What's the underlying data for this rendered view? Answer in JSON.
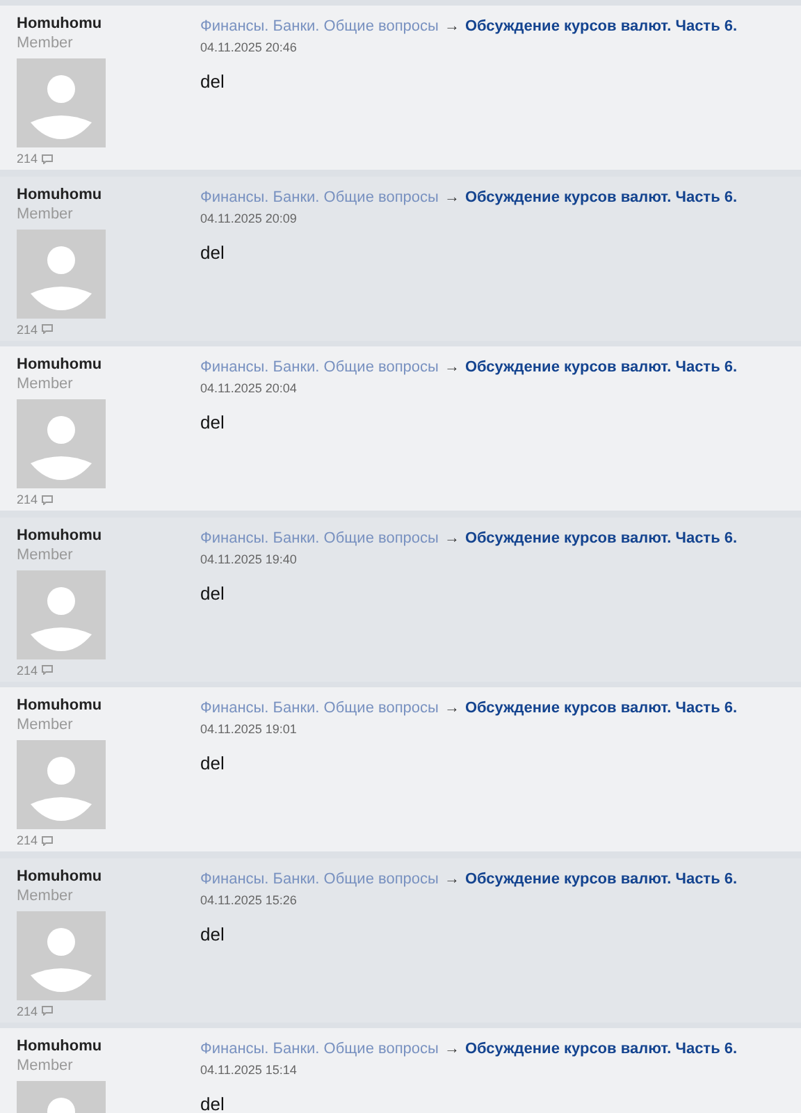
{
  "posts": [
    {
      "author": "Homuhomu",
      "role": "Member",
      "count": "214",
      "forum": "Финансы. Банки. Общие вопросы",
      "arrow": "→",
      "topic": "Обсуждение курсов валют. Часть 6.",
      "date": "04.11.2025 20:46",
      "body": "del",
      "shaded": false
    },
    {
      "author": "Homuhomu",
      "role": "Member",
      "count": "214",
      "forum": "Финансы. Банки. Общие вопросы",
      "arrow": "→",
      "topic": "Обсуждение курсов валют. Часть 6.",
      "date": "04.11.2025 20:09",
      "body": "del",
      "shaded": true
    },
    {
      "author": "Homuhomu",
      "role": "Member",
      "count": "214",
      "forum": "Финансы. Банки. Общие вопросы",
      "arrow": "→",
      "topic": "Обсуждение курсов валют. Часть 6.",
      "date": "04.11.2025 20:04",
      "body": "del",
      "shaded": false
    },
    {
      "author": "Homuhomu",
      "role": "Member",
      "count": "214",
      "forum": "Финансы. Банки. Общие вопросы",
      "arrow": "→",
      "topic": "Обсуждение курсов валют. Часть 6.",
      "date": "04.11.2025 19:40",
      "body": "del",
      "shaded": true
    },
    {
      "author": "Homuhomu",
      "role": "Member",
      "count": "214",
      "forum": "Финансы. Банки. Общие вопросы",
      "arrow": "→",
      "topic": "Обсуждение курсов валют. Часть 6.",
      "date": "04.11.2025 19:01",
      "body": "del",
      "shaded": false
    },
    {
      "author": "Homuhomu",
      "role": "Member",
      "count": "214",
      "forum": "Финансы. Банки. Общие вопросы",
      "arrow": "→",
      "topic": "Обсуждение курсов валют. Часть 6.",
      "date": "04.11.2025 15:26",
      "body": "del",
      "shaded": true
    },
    {
      "author": "Homuhomu",
      "role": "Member",
      "forum": "Финансы. Банки. Общие вопросы",
      "arrow": "→",
      "topic": "Обсуждение курсов валют. Часть 6.",
      "date": "04.11.2025 15:14",
      "body": "del",
      "shaded": false
    }
  ]
}
